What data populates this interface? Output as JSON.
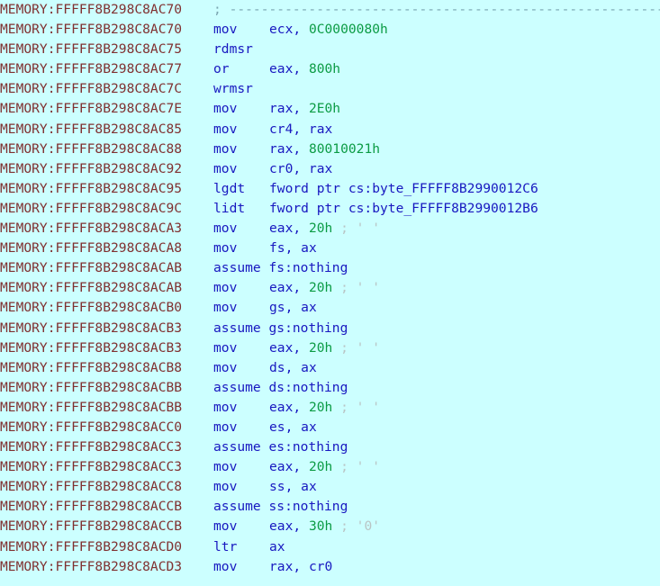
{
  "view": {
    "name": "IDA Pro disassembly listing",
    "segment": "MEMORY",
    "background_color": "#ccffff",
    "address_color": "#803030",
    "mnemonic_color": "#1818c0",
    "register_color": "#1818c0",
    "number_color": "#0b9b44",
    "comment_color": "#b9c4c4"
  },
  "lines": [
    {
      "addr": "MEMORY:FFFFF8B298C8AC70",
      "kind": "comment",
      "mnem": "",
      "ops": "",
      "comment": "; ----------------------------------------------------------------------",
      "text": ""
    },
    {
      "addr": "MEMORY:FFFFF8B298C8AC70",
      "kind": "insn",
      "mnem": "mov",
      "op1": "ecx,",
      "op2": "0C0000080h",
      "comment": ""
    },
    {
      "addr": "MEMORY:FFFFF8B298C8AC75",
      "kind": "insn",
      "mnem": "rdmsr",
      "op1": "",
      "op2": "",
      "comment": ""
    },
    {
      "addr": "MEMORY:FFFFF8B298C8AC77",
      "kind": "insn",
      "mnem": "or",
      "op1": "eax,",
      "op2": "800h",
      "comment": ""
    },
    {
      "addr": "MEMORY:FFFFF8B298C8AC7C",
      "kind": "insn",
      "mnem": "wrmsr",
      "op1": "",
      "op2": "",
      "comment": ""
    },
    {
      "addr": "MEMORY:FFFFF8B298C8AC7E",
      "kind": "insn",
      "mnem": "mov",
      "op1": "rax,",
      "op2": "2E0h",
      "comment": ""
    },
    {
      "addr": "MEMORY:FFFFF8B298C8AC85",
      "kind": "insn",
      "mnem": "mov",
      "op1": "cr4,",
      "op2": "rax",
      "op2kind": "reg",
      "comment": ""
    },
    {
      "addr": "MEMORY:FFFFF8B298C8AC88",
      "kind": "insn",
      "mnem": "mov",
      "op1": "rax,",
      "op2": "80010021h",
      "comment": ""
    },
    {
      "addr": "MEMORY:FFFFF8B298C8AC92",
      "kind": "insn",
      "mnem": "mov",
      "op1": "cr0,",
      "op2": "rax",
      "op2kind": "reg",
      "comment": ""
    },
    {
      "addr": "MEMORY:FFFFF8B298C8AC95",
      "kind": "insn",
      "mnem": "lgdt",
      "op1": "fword ptr cs:byte_FFFFF8B2990012C6",
      "op2": "",
      "op1kind": "reg",
      "comment": ""
    },
    {
      "addr": "MEMORY:FFFFF8B298C8AC9C",
      "kind": "insn",
      "mnem": "lidt",
      "op1": "fword ptr cs:byte_FFFFF8B2990012B6",
      "op2": "",
      "op1kind": "reg",
      "comment": ""
    },
    {
      "addr": "MEMORY:FFFFF8B298C8ACA3",
      "kind": "insn",
      "mnem": "mov",
      "op1": "eax,",
      "op2": "20h",
      "comment": "; ' '"
    },
    {
      "addr": "MEMORY:FFFFF8B298C8ACA8",
      "kind": "insn",
      "mnem": "mov",
      "op1": "fs,",
      "op2": "ax",
      "op2kind": "reg",
      "comment": ""
    },
    {
      "addr": "MEMORY:FFFFF8B298C8ACAB",
      "kind": "directive",
      "mnem": "assume",
      "ops": "fs:nothing",
      "comment": ""
    },
    {
      "addr": "MEMORY:FFFFF8B298C8ACAB",
      "kind": "insn",
      "mnem": "mov",
      "op1": "eax,",
      "op2": "20h",
      "comment": "; ' '"
    },
    {
      "addr": "MEMORY:FFFFF8B298C8ACB0",
      "kind": "insn",
      "mnem": "mov",
      "op1": "gs,",
      "op2": "ax",
      "op2kind": "reg",
      "comment": ""
    },
    {
      "addr": "MEMORY:FFFFF8B298C8ACB3",
      "kind": "directive",
      "mnem": "assume",
      "ops": "gs:nothing",
      "comment": ""
    },
    {
      "addr": "MEMORY:FFFFF8B298C8ACB3",
      "kind": "insn",
      "mnem": "mov",
      "op1": "eax,",
      "op2": "20h",
      "comment": "; ' '"
    },
    {
      "addr": "MEMORY:FFFFF8B298C8ACB8",
      "kind": "insn",
      "mnem": "mov",
      "op1": "ds,",
      "op2": "ax",
      "op2kind": "reg",
      "comment": ""
    },
    {
      "addr": "MEMORY:FFFFF8B298C8ACBB",
      "kind": "directive",
      "mnem": "assume",
      "ops": "ds:nothing",
      "comment": ""
    },
    {
      "addr": "MEMORY:FFFFF8B298C8ACBB",
      "kind": "insn",
      "mnem": "mov",
      "op1": "eax,",
      "op2": "20h",
      "comment": "; ' '"
    },
    {
      "addr": "MEMORY:FFFFF8B298C8ACC0",
      "kind": "insn",
      "mnem": "mov",
      "op1": "es,",
      "op2": "ax",
      "op2kind": "reg",
      "comment": ""
    },
    {
      "addr": "MEMORY:FFFFF8B298C8ACC3",
      "kind": "directive",
      "mnem": "assume",
      "ops": "es:nothing",
      "comment": ""
    },
    {
      "addr": "MEMORY:FFFFF8B298C8ACC3",
      "kind": "insn",
      "mnem": "mov",
      "op1": "eax,",
      "op2": "20h",
      "comment": "; ' '"
    },
    {
      "addr": "MEMORY:FFFFF8B298C8ACC8",
      "kind": "insn",
      "mnem": "mov",
      "op1": "ss,",
      "op2": "ax",
      "op2kind": "reg",
      "comment": ""
    },
    {
      "addr": "MEMORY:FFFFF8B298C8ACCB",
      "kind": "directive",
      "mnem": "assume",
      "ops": "ss:nothing",
      "comment": ""
    },
    {
      "addr": "MEMORY:FFFFF8B298C8ACCB",
      "kind": "insn",
      "mnem": "mov",
      "op1": "eax,",
      "op2": "30h",
      "comment": "; '0'"
    },
    {
      "addr": "MEMORY:FFFFF8B298C8ACD0",
      "kind": "insn",
      "mnem": "ltr",
      "op1": "ax",
      "op2": "",
      "op1kind": "reg",
      "comment": ""
    },
    {
      "addr": "MEMORY:FFFFF8B298C8ACD3",
      "kind": "insn",
      "mnem": "mov",
      "op1": "rax,",
      "op2": "cr0",
      "op2kind": "reg",
      "comment": ""
    }
  ]
}
